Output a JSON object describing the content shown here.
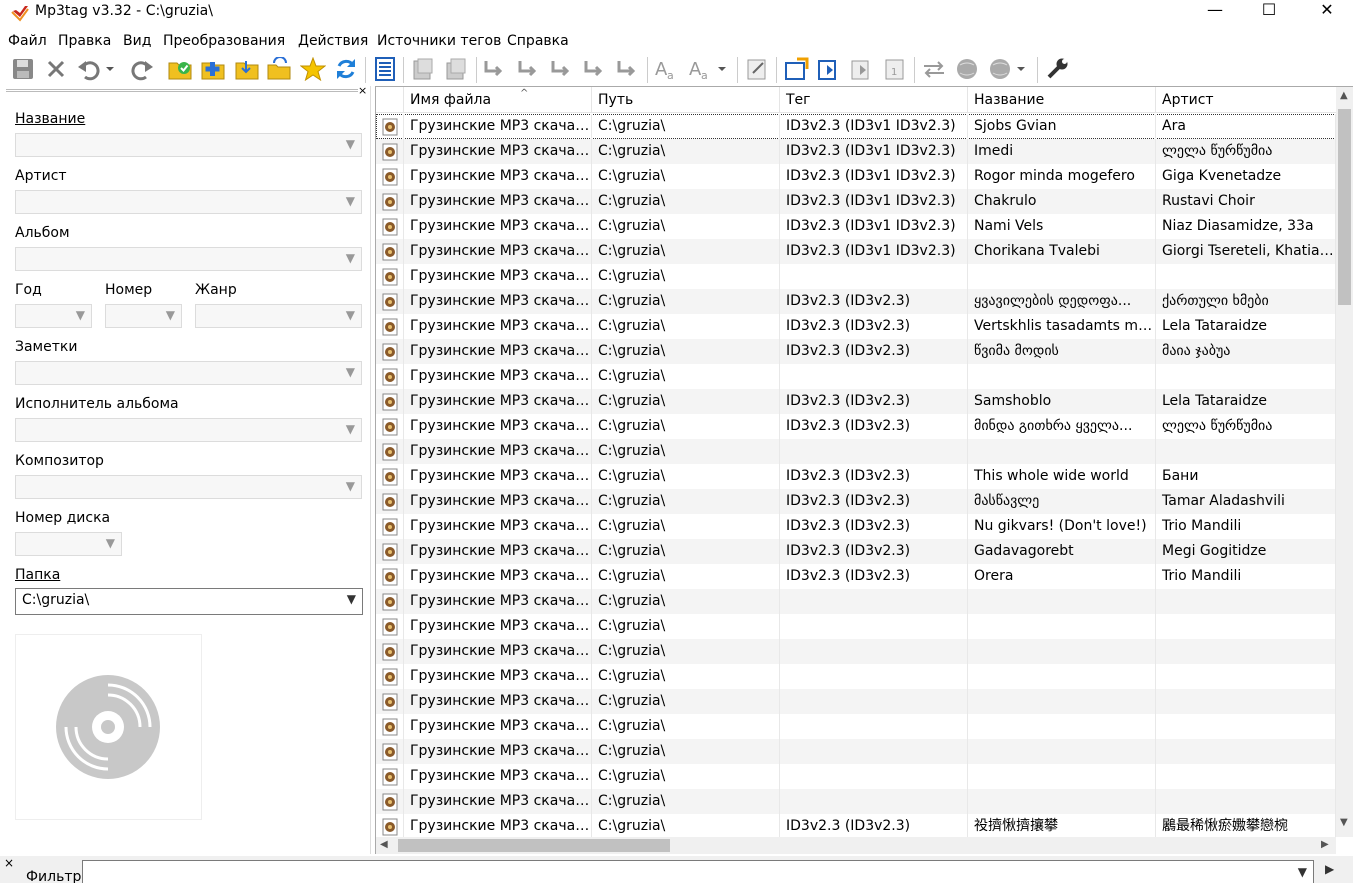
{
  "window": {
    "title": "Mp3tag v3.32  -  C:\\gruzia\\",
    "minimize": "—",
    "maximize": "☐",
    "close": "✕"
  },
  "menu": [
    "Файл",
    "Правка",
    "Вид",
    "Преобразования",
    "Действия",
    "Источники тегов",
    "Справка"
  ],
  "panel": {
    "close": "×",
    "title_label": "Название",
    "artist_label": "Артист",
    "album_label": "Альбом",
    "year_label": "Год",
    "track_label": "Номер",
    "genre_label": "Жанр",
    "comment_label": "Заметки",
    "album_artist_label": "Исполнитель альбома",
    "composer_label": "Композитор",
    "disc_label": "Номер диска",
    "folder_label": "Папка",
    "folder_value": "C:\\gruzia\\"
  },
  "columns": {
    "filename": "Имя файла",
    "path": "Путь",
    "tag": "Тег",
    "title": "Название",
    "artist": "Артист"
  },
  "rows": [
    {
      "file": "Грузинские MP3 скачат...",
      "path": "C:\\gruzia\\",
      "tag": "ID3v2.3 (ID3v1 ID3v2.3)",
      "title": "Sjobs Gvian",
      "artist": "Ara"
    },
    {
      "file": "Грузинские MP3 скачат...",
      "path": "C:\\gruzia\\",
      "tag": "ID3v2.3 (ID3v1 ID3v2.3)",
      "title": "Imedi",
      "artist": "ლელა წურწუმია"
    },
    {
      "file": "Грузинские MP3 скачат...",
      "path": "C:\\gruzia\\",
      "tag": "ID3v2.3 (ID3v1 ID3v2.3)",
      "title": "Rogor minda mogefero",
      "artist": "Giga Kvenetadze"
    },
    {
      "file": "Грузинские MP3 скачат...",
      "path": "C:\\gruzia\\",
      "tag": "ID3v2.3 (ID3v1 ID3v2.3)",
      "title": "Chakrulo",
      "artist": "Rustavi Choir"
    },
    {
      "file": "Грузинские MP3 скачат...",
      "path": "C:\\gruzia\\",
      "tag": "ID3v2.3 (ID3v1 ID3v2.3)",
      "title": "Nami Vels",
      "artist": "Niaz Diasamidze, 33a"
    },
    {
      "file": "Грузинские MP3 скачат...",
      "path": "C:\\gruzia\\",
      "tag": "ID3v2.3 (ID3v1 ID3v2.3)",
      "title": "Chorikana Tvalebi",
      "artist": "Giorgi Tsereteli, Khatia C..."
    },
    {
      "file": "Грузинские MP3 скачат...",
      "path": "C:\\gruzia\\",
      "tag": "",
      "title": "",
      "artist": ""
    },
    {
      "file": "Грузинские MP3 скачат...",
      "path": "C:\\gruzia\\",
      "tag": "ID3v2.3 (ID3v2.3)",
      "title": "ყვავილების დედოფა...",
      "artist": "ქართული ხმები"
    },
    {
      "file": "Грузинские MP3 скачат...",
      "path": "C:\\gruzia\\",
      "tag": "ID3v2.3 (ID3v2.3)",
      "title": "Vertskhlis tasadamts mak...",
      "artist": "Lela Tataraidze"
    },
    {
      "file": "Грузинские MP3 скачат...",
      "path": "C:\\gruzia\\",
      "tag": "ID3v2.3 (ID3v2.3)",
      "title": "წვიმა მოდის",
      "artist": "მაია ჯაბუა"
    },
    {
      "file": "Грузинские MP3 скачат...",
      "path": "C:\\gruzia\\",
      "tag": "",
      "title": "",
      "artist": ""
    },
    {
      "file": "Грузинские MP3 скачат...",
      "path": "C:\\gruzia\\",
      "tag": "ID3v2.3 (ID3v2.3)",
      "title": "Samshoblo",
      "artist": "Lela Tataraidze"
    },
    {
      "file": "Грузинские MP3 скачат...",
      "path": "C:\\gruzia\\",
      "tag": "ID3v2.3 (ID3v2.3)",
      "title": "მინდა გითხრა ყველა...",
      "artist": "ლელა წურწუმია"
    },
    {
      "file": "Грузинские MP3 скачат...",
      "path": "C:\\gruzia\\",
      "tag": "",
      "title": "",
      "artist": ""
    },
    {
      "file": "Грузинские MP3 скачат...",
      "path": "C:\\gruzia\\",
      "tag": "ID3v2.3 (ID3v2.3)",
      "title": "This whole wide world",
      "artist": "Бани"
    },
    {
      "file": "Грузинские MP3 скачат...",
      "path": "C:\\gruzia\\",
      "tag": "ID3v2.3 (ID3v2.3)",
      "title": "მასწავლე",
      "artist": "Tamar Aladashvili"
    },
    {
      "file": "Грузинские MP3 скачат...",
      "path": "C:\\gruzia\\",
      "tag": "ID3v2.3 (ID3v2.3)",
      "title": "Nu gikvars! (Don't love!)",
      "artist": "Trio Mandili"
    },
    {
      "file": "Грузинские MP3 скачат...",
      "path": "C:\\gruzia\\",
      "tag": "ID3v2.3 (ID3v2.3)",
      "title": "Gadavagorebt",
      "artist": "Megi Gogitidze"
    },
    {
      "file": "Грузинские MP3 скачат...",
      "path": "C:\\gruzia\\",
      "tag": "ID3v2.3 (ID3v2.3)",
      "title": "Orera",
      "artist": "Trio Mandili"
    },
    {
      "file": "Грузинские MP3 скачат...",
      "path": "C:\\gruzia\\",
      "tag": "",
      "title": "",
      "artist": ""
    },
    {
      "file": "Грузинские MP3 скачат...",
      "path": "C:\\gruzia\\",
      "tag": "",
      "title": "",
      "artist": ""
    },
    {
      "file": "Грузинские MP3 скачат...",
      "path": "C:\\gruzia\\",
      "tag": "",
      "title": "",
      "artist": ""
    },
    {
      "file": "Грузинские MP3 скачат...",
      "path": "C:\\gruzia\\",
      "tag": "",
      "title": "",
      "artist": ""
    },
    {
      "file": "Грузинские MP3 скачат...",
      "path": "C:\\gruzia\\",
      "tag": "",
      "title": "",
      "artist": ""
    },
    {
      "file": "Грузинские MP3 скачат...",
      "path": "C:\\gruzia\\",
      "tag": "",
      "title": "",
      "artist": ""
    },
    {
      "file": "Грузинские MP3 скачат...",
      "path": "C:\\gruzia\\",
      "tag": "",
      "title": "",
      "artist": ""
    },
    {
      "file": "Грузинские MP3 скачат...",
      "path": "C:\\gruzia\\",
      "tag": "",
      "title": "",
      "artist": ""
    },
    {
      "file": "Грузинские MP3 скачат...",
      "path": "C:\\gruzia\\",
      "tag": "",
      "title": "",
      "artist": ""
    },
    {
      "file": "Грузинские MP3 скачат...",
      "path": "C:\\gruzia\\",
      "tag": "ID3v2.3 (ID3v2.3)",
      "title": "祋擠愀擠攘攀",
      "artist": "鷵最稀愀瘀嫐攀戀椀"
    }
  ],
  "filter": {
    "close": "×",
    "label": "Фильтр",
    "value": ""
  }
}
